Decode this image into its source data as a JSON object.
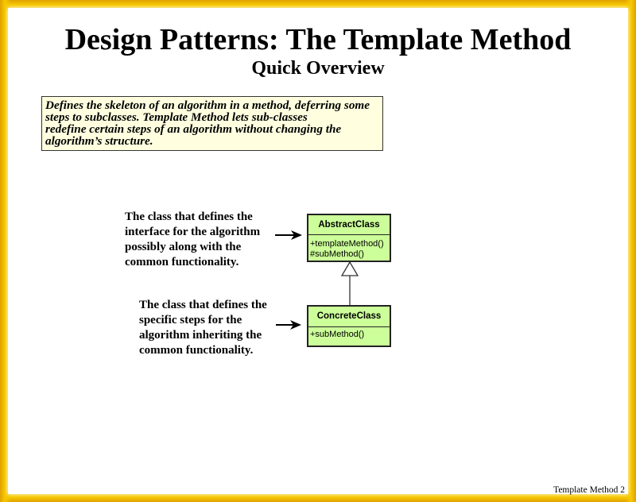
{
  "slide": {
    "title": "Design Patterns: The Template Method",
    "subtitle": "Quick Overview",
    "definition_lines": [
      "Defines the skeleton of an algorithm in a method, deferring some",
      "steps to subclasses.  Template Method lets sub-classes",
      "redefine certain steps of an algorithm without changing the",
      "algorithm’s structure."
    ],
    "footer": "Template Method 2"
  },
  "diagram": {
    "abstract_description": [
      "The class that defines the",
      "interface for the algorithm",
      "possibly along with the",
      "common functionality."
    ],
    "concrete_description": [
      "The class that defines the",
      "specific steps for the",
      "algorithm inheriting the",
      "common functionality."
    ],
    "abstract_class": {
      "name": "AbstractClass",
      "operations": [
        "+templateMethod()",
        "#subMethod()"
      ]
    },
    "concrete_class": {
      "name": "ConcreteClass",
      "operations": [
        "+subMethod()"
      ]
    },
    "colors": {
      "class_fill": "#ccff99",
      "definition_fill": "#ffffe0",
      "frame": "#f0b800"
    }
  }
}
